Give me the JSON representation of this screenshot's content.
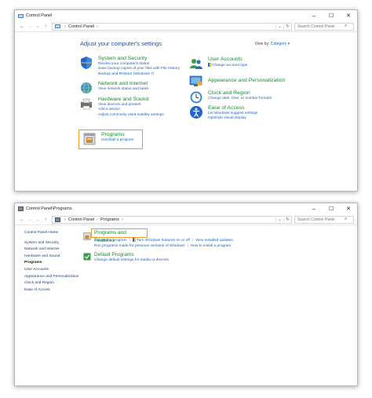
{
  "window1": {
    "title": "Control Panel",
    "address": [
      "Control Panel"
    ],
    "search_placeholder": "Search Control Panel",
    "heading": "Adjust your computer's settings",
    "view_by_label": "View by:",
    "view_by_value": "Category",
    "categories": [
      {
        "title": "System and Security",
        "icon": "shield-icon",
        "links": [
          "Review your computer's status",
          "Save backup copies of your files with File History",
          "Backup and Restore (Windows 7)"
        ]
      },
      {
        "title": "Network and Internet",
        "icon": "network-icon",
        "links": [
          "View network status and tasks"
        ]
      },
      {
        "title": "Hardware and Sound",
        "icon": "printer-icon",
        "links": [
          "View devices and printers",
          "Add a device",
          "Adjust commonly used mobility settings"
        ]
      },
      {
        "title": "Programs",
        "icon": "programs-icon",
        "links": [
          "Uninstall a program"
        ]
      },
      {
        "title": "User Accounts",
        "icon": "users-icon",
        "links": [
          "Change account type"
        ]
      },
      {
        "title": "Appearance and Personalization",
        "icon": "appearance-icon",
        "links": []
      },
      {
        "title": "Clock and Region",
        "icon": "clock-icon",
        "links": [
          "Change date, time, or number formats"
        ]
      },
      {
        "title": "Ease of Access",
        "icon": "ease-of-access-icon",
        "links": [
          "Let Windows suggest settings",
          "Optimize visual display"
        ]
      }
    ]
  },
  "window2": {
    "title": "Control Panel\\Programs",
    "address": [
      "Control Panel",
      "Programs"
    ],
    "search_placeholder": "Search Control Panel",
    "nav": [
      "Control Panel Home",
      "System and Security",
      "Network and Internet",
      "Hardware and Sound",
      "Programs",
      "User Accounts",
      "Appearance and Personalization",
      "Clock and Region",
      "Ease of Access"
    ],
    "programs_features": {
      "title": "Programs and Features",
      "row1": [
        "Uninstall a program",
        "Turn Windows features on or off",
        "View installed updates"
      ],
      "row2": [
        "Run programs made for previous versions of Windows",
        "How to install a program"
      ]
    },
    "default_programs": {
      "title": "Default Programs",
      "links": [
        "Change default settings for media or devices"
      ]
    }
  },
  "colors": {
    "highlight": "#f09a2a",
    "category_title": "#1a8a32",
    "link": "#1a63c6",
    "heading": "#1e4e9c"
  }
}
